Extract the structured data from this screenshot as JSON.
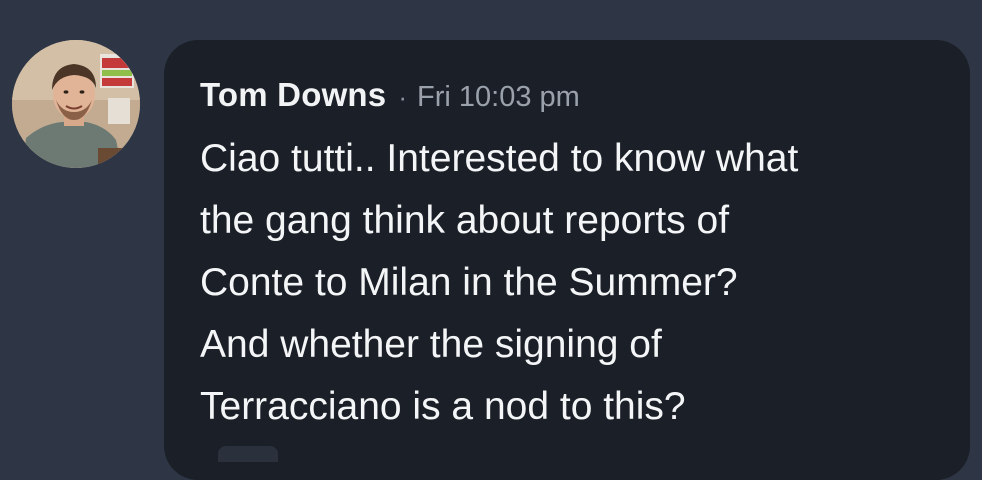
{
  "message": {
    "author": "Tom Downs",
    "separator": "·",
    "timestamp": "Fri 10:03 pm",
    "lines": [
      "Ciao tutti.. Interested to know what",
      "the gang think about reports of",
      "Conte to Milan in the Summer?",
      "And whether the signing of",
      "Terracciano is a nod to this?"
    ]
  },
  "colors": {
    "background": "#2e3646",
    "bubble": "#1b2028",
    "author_text": "#f2f3f5",
    "timestamp_text": "#9aa1ab",
    "body_text": "#f4f5f7"
  }
}
